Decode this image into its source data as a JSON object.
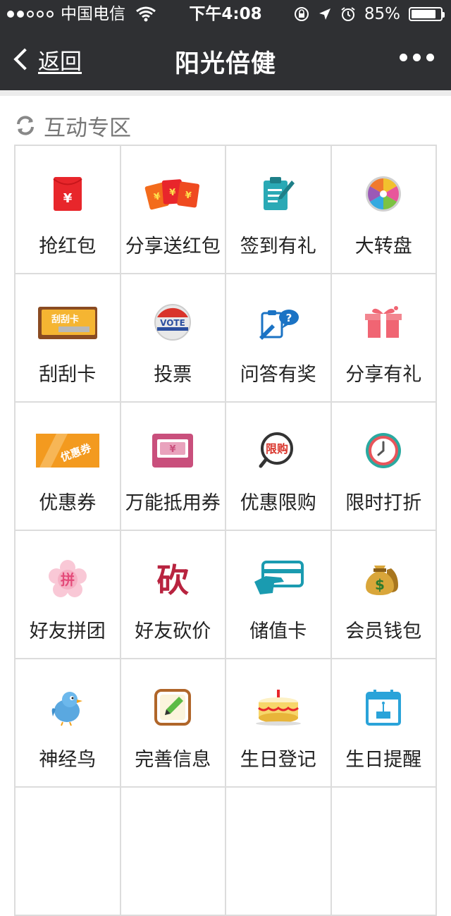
{
  "status_bar": {
    "carrier": "中国电信",
    "time": "下午4:08",
    "battery": "85%",
    "battery_level": 0.85
  },
  "nav": {
    "back_label": "返回",
    "title": "阳光倍健"
  },
  "section": {
    "title": "互动专区",
    "icon": "refresh-icon"
  },
  "items": [
    {
      "label": "抢红包",
      "icon": "red-envelope-icon"
    },
    {
      "label": "分享送红包",
      "icon": "share-red-envelopes-icon"
    },
    {
      "label": "签到有礼",
      "icon": "sign-in-clipboard-icon"
    },
    {
      "label": "大转盘",
      "icon": "prize-wheel-icon"
    },
    {
      "label": "刮刮卡",
      "icon": "scratch-card-icon"
    },
    {
      "label": "投票",
      "icon": "vote-badge-icon"
    },
    {
      "label": "问答有奖",
      "icon": "quiz-icon"
    },
    {
      "label": "分享有礼",
      "icon": "gift-icon"
    },
    {
      "label": "优惠券",
      "icon": "coupon-icon"
    },
    {
      "label": "万能抵用券",
      "icon": "voucher-icon"
    },
    {
      "label": "优惠限购",
      "icon": "limited-purchase-icon"
    },
    {
      "label": "限时打折",
      "icon": "clock-icon"
    },
    {
      "label": "好友拼团",
      "icon": "group-buy-icon"
    },
    {
      "label": "好友砍价",
      "icon": "bargain-icon"
    },
    {
      "label": "储值卡",
      "icon": "stored-value-card-icon"
    },
    {
      "label": "会员钱包",
      "icon": "money-bag-icon"
    },
    {
      "label": "神经鸟",
      "icon": "bird-icon"
    },
    {
      "label": "完善信息",
      "icon": "edit-info-icon"
    },
    {
      "label": "生日登记",
      "icon": "birthday-cake-icon"
    },
    {
      "label": "生日提醒",
      "icon": "birthday-calendar-icon"
    }
  ],
  "icon_text": {
    "yen": "¥",
    "scratch": "刮刮卡",
    "vote": "VOTE",
    "quiz": "?",
    "coupon": "优惠券",
    "group": "拼",
    "bargain": "砍",
    "limit": "限购",
    "dollar": "$"
  },
  "colors": {
    "header_bg": "#2f3033",
    "red": "#e8262b",
    "teal": "#2aa9b5",
    "pink": "#e56a8b",
    "orange": "#f39a1f"
  }
}
